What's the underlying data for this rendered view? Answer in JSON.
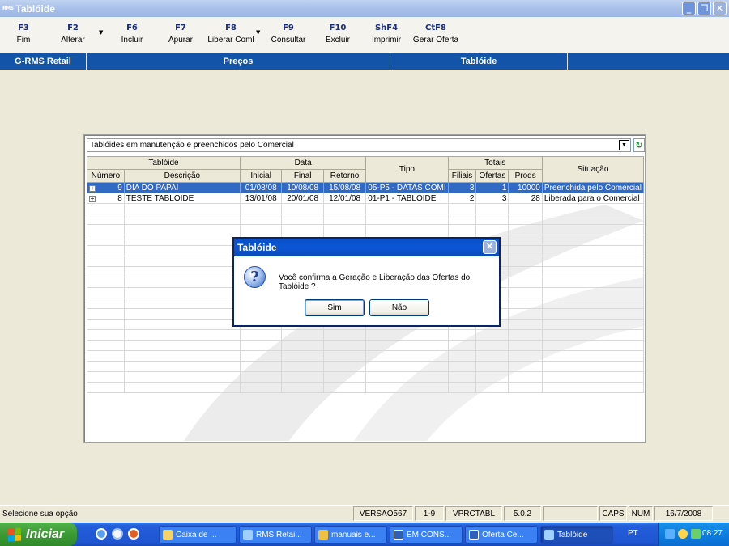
{
  "window": {
    "app_icon_text": "RMS",
    "title": "Tablóide",
    "controls": [
      "_",
      "❐",
      "✕"
    ]
  },
  "toolbar": [
    {
      "key": "F3",
      "label": "Fim"
    },
    {
      "key": "F2",
      "label": "Alterar"
    },
    {
      "key": "F6",
      "label": "Incluir"
    },
    {
      "key": "F7",
      "label": "Apurar"
    },
    {
      "key": "F8",
      "label": "Liberar Coml"
    },
    {
      "key": "F9",
      "label": "Consultar"
    },
    {
      "key": "F10",
      "label": "Excluir"
    },
    {
      "key": "ShF4",
      "label": "Imprimir"
    },
    {
      "key": "CtF8",
      "label": "Gerar Oferta"
    }
  ],
  "header_bar": {
    "left": "G-RMS Retail",
    "center": "Preços",
    "right": "Tablóide"
  },
  "filter": {
    "selected": "Tablóides em manutenção e preenchidos pelo Comercial"
  },
  "grid": {
    "group_headers": {
      "tabloide": "Tablóide",
      "data": "Data",
      "tipo": "Tipo",
      "totais": "Totais",
      "situacao": "Situação"
    },
    "columns": [
      "Número",
      "Descrição",
      "Inicial",
      "Final",
      "Retorno",
      "Filiais",
      "Ofertas",
      "Prods"
    ],
    "rows": [
      {
        "numero": "9",
        "descricao": "DIA DO PAPAI",
        "inicial": "01/08/08",
        "final": "10/08/08",
        "retorno": "15/08/08",
        "tipo": "05-P5 - DATAS COMI",
        "filiais": "3",
        "ofertas": "1",
        "prods": "10000",
        "situacao": "Preenchida pelo Comercial",
        "selected": true
      },
      {
        "numero": "8",
        "descricao": "TESTE TABLOIDE",
        "inicial": "13/01/08",
        "final": "20/01/08",
        "retorno": "12/01/08",
        "tipo": "01-P1 - TABLOIDE",
        "filiais": "2",
        "ofertas": "3",
        "prods": "28",
        "situacao": "Liberada para o Comercial",
        "selected": false
      }
    ]
  },
  "dialog": {
    "title": "Tablóide",
    "message": "Você confirma a Geração e Liberação das Ofertas do Tablóide ?",
    "yes_label": "Sim",
    "no_label": "Não",
    "close_glyph": "✕"
  },
  "statusbar": {
    "message": "Selecione sua opção",
    "version": "VERSAO567",
    "page": "1-9",
    "module": "VPRCTABL",
    "release": "5.0.2",
    "caps": "CAPS",
    "num": "NUM",
    "date": "16/7/2008"
  },
  "taskbar": {
    "start_label": "Iniciar",
    "tasks": [
      "Caixa de ...",
      "RMS Retai...",
      "manuais e...",
      "EM CONS...",
      "Oferta Ce...",
      "Tablóide"
    ],
    "language": "PT",
    "clock": "08:27"
  },
  "colors": {
    "header_blue": "#1454a8",
    "selection_blue": "#316ac5",
    "dialog_title_blue": "#0b56d6",
    "start_green": "#3c9a34"
  }
}
